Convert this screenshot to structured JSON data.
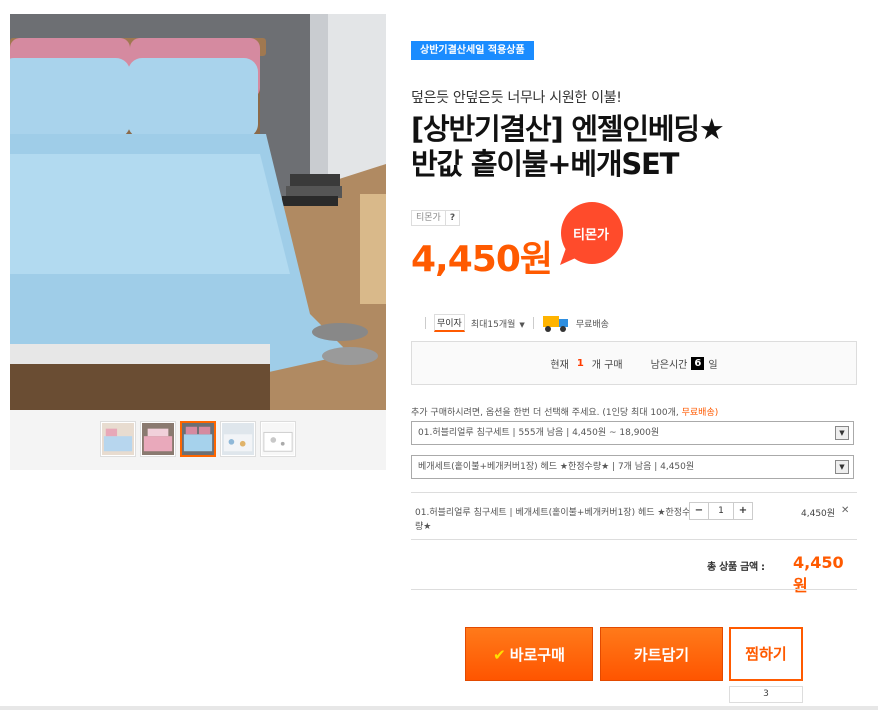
{
  "gallery": {
    "thumb_count": 5,
    "active_thumb_index": 2
  },
  "product": {
    "sale_badge": "상반기결산세일 적용상품",
    "subtitle": "덮은듯 안덮은듯 너무나 시원한 이불!",
    "title_line1": "[상반기결산] 엔젤인베딩★",
    "title_line2": "반값 홑이불+베개SET",
    "price_label": "티몬가",
    "price_help": "?",
    "price": "4,450원",
    "price_bubble": "티몬가"
  },
  "benefits": {
    "installment_badge": "무이자",
    "installment_text": "최대15개월",
    "shipping_text": "무료배송"
  },
  "status": {
    "current_prefix": "현재",
    "current_count": "1",
    "current_suffix": "개 구매",
    "remaining_prefix": "남은시간",
    "remaining_days": "6",
    "remaining_suffix": "일"
  },
  "options": {
    "guide": "추가 구매하시려면, 옵션을 한번 더 선택해 주세요. (1인당 최대 100개,",
    "guide_highlight": "무료배송)",
    "select1": "01.허블리얼루 침구세트 | 555개 남음 | 4,450원 ~ 18,900원",
    "select2": "베개세트(홑이불+베개커버1장) 헤드 ★한정수량★ | 7개 남음 | 4,450원"
  },
  "chosen": {
    "text": "01.허블리얼루 침구세트 | 베개세트(홑이불+베개커버1장) 헤드 ★한정수량★",
    "minus": "−",
    "quantity": "1",
    "plus": "+",
    "price": "4,450원",
    "remove": "✕"
  },
  "total": {
    "label": "총 상품 금액 :",
    "price": "4,450원"
  },
  "actions": {
    "buy_check": "✔",
    "buy": "바로구매",
    "cart": "카트담기",
    "wish": "찜하기",
    "wish_count": "3"
  },
  "colors": {
    "accent": "#ff5a00",
    "badge_blue": "#1a8cff",
    "bubble_red": "#ff4b2b"
  }
}
